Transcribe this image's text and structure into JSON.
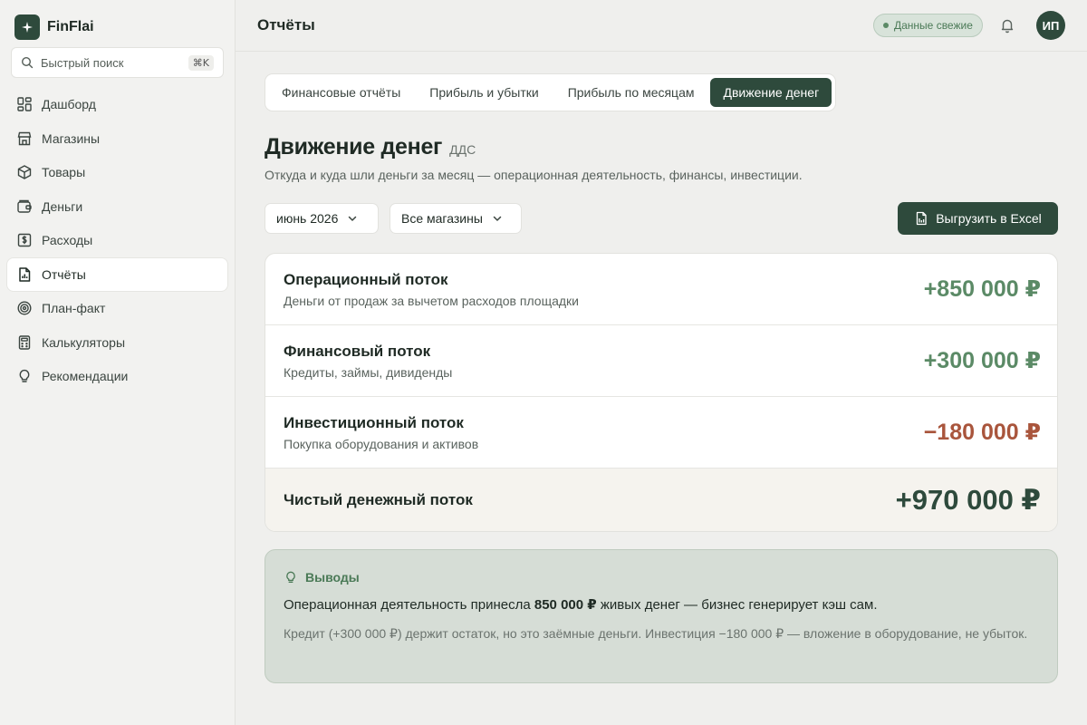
{
  "app": {
    "name": "FinFlai"
  },
  "search": {
    "label": "Быстрый поиск",
    "shortcut": "⌘K"
  },
  "sidebar": {
    "items": [
      {
        "label": "Дашборд",
        "icon": "dashboard-icon"
      },
      {
        "label": "Магазины",
        "icon": "store-icon"
      },
      {
        "label": "Товары",
        "icon": "box-icon"
      },
      {
        "label": "Деньги",
        "icon": "wallet-icon"
      },
      {
        "label": "Расходы",
        "icon": "expenses-icon"
      },
      {
        "label": "Отчёты",
        "icon": "report-icon",
        "active": true
      },
      {
        "label": "План-факт",
        "icon": "target-icon"
      },
      {
        "label": "Калькуляторы",
        "icon": "calculator-icon"
      },
      {
        "label": "Рекомендации",
        "icon": "lightbulb-icon"
      }
    ]
  },
  "header": {
    "title": "Отчёты",
    "status_badge": "Данные свежие",
    "avatar_initials": "ИП"
  },
  "tabs": [
    {
      "label": "Финансовые отчёты"
    },
    {
      "label": "Прибыль и убытки"
    },
    {
      "label": "Прибыль по месяцам"
    },
    {
      "label": "Движение денег",
      "active": true
    }
  ],
  "main": {
    "heading": "Движение денег",
    "heading_tag": "ДДС",
    "subtitle": "Откуда и куда шли деньги за месяц — операционная деятельность, финансы, инвестиции.",
    "period_select": "июнь 2026",
    "store_select": "Все магазины",
    "export_label": "Выгрузить в Excel"
  },
  "flows": [
    {
      "title": "Операционный поток",
      "desc": "Деньги от продаж за вычетом расходов площадки",
      "value": "+850 000 ₽",
      "sign": "positive"
    },
    {
      "title": "Финансовый поток",
      "desc": "Кредиты, займы, дивиденды",
      "value": "+300 000 ₽",
      "sign": "positive"
    },
    {
      "title": "Инвестиционный поток",
      "desc": "Покупка оборудования и активов",
      "value": "−180 000 ₽",
      "sign": "negative"
    }
  ],
  "net": {
    "label": "Чистый денежный поток",
    "value": "+970 000 ₽"
  },
  "insights": {
    "title": "Выводы",
    "main_prefix": "Операционная деятельность принесла ",
    "main_bold": "850 000 ₽",
    "main_suffix": " живых денег — бизнес генерирует кэш сам.",
    "note": "Кредит (+300 000 ₽) держит остаток, но это заёмные деньги. Инвестиция −180 000 ₽ — вложение в оборудование, не убыток."
  },
  "colors": {
    "brand": "#2e4a3c",
    "positive": "#5b8a66",
    "negative": "#a9553c"
  }
}
